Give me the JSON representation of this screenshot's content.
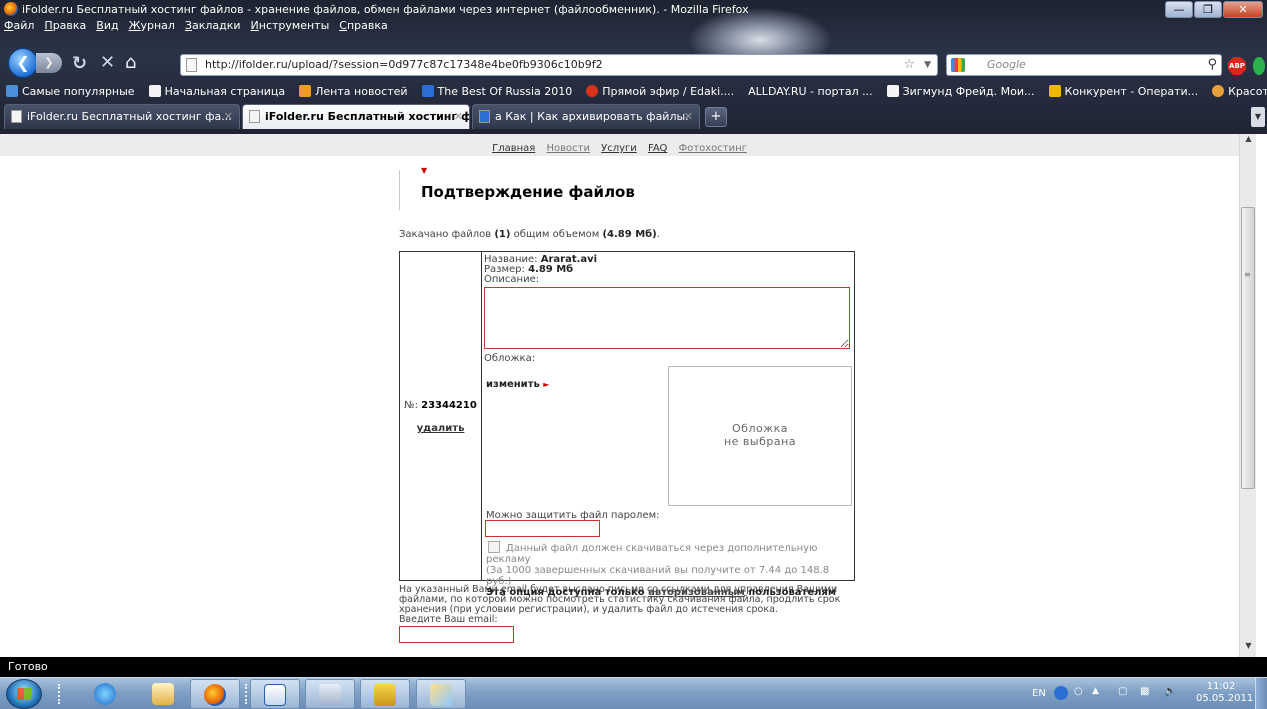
{
  "window": {
    "title": "iFolder.ru Бесплатный хостинг файлов - хранение файлов, обмен файлами через интернет (файлообменник). - Mozilla Firefox"
  },
  "menubar": [
    "Файл",
    "Правка",
    "Вид",
    "Журнал",
    "Закладки",
    "Инструменты",
    "Справка"
  ],
  "navbar": {
    "url": "http://ifolder.ru/upload/?session=0d977c87c17348e4be0fb9306c10b9f2",
    "search_placeholder": "Google"
  },
  "bookmarks": [
    {
      "label": "Самые популярные",
      "color": "#4a90d9"
    },
    {
      "label": "Начальная страница",
      "color": "#f4f4f4"
    },
    {
      "label": "Лента новостей",
      "color": "#f29a24"
    },
    {
      "label": "The Best Of Russia 2010",
      "color": "#2a6fd1"
    },
    {
      "label": "Прямой эфир / Edaki....",
      "color": "#d9321a"
    },
    {
      "label": "ALLDAY.RU - портал ...",
      "color": "#9ca6b8"
    },
    {
      "label": "Зигмунд Фрейд. Мои...",
      "color": "#f4f4f4"
    },
    {
      "label": "Конкурент - Операти...",
      "color": "#f0b800"
    },
    {
      "label": "Красота - Мода (раст...",
      "color": "#e8a03c"
    }
  ],
  "tabs": [
    {
      "label": "iFolder.ru Бесплатный хостинг фа...",
      "active": false
    },
    {
      "label": "iFolder.ru Бесплатный хостинг ф...",
      "active": true
    },
    {
      "label": "а Как | Как архивировать файлы.",
      "active": false
    }
  ],
  "site_menu": [
    {
      "label": "Главная",
      "dim": false
    },
    {
      "label": "Новости",
      "dim": true
    },
    {
      "label": "Услуги",
      "dim": false
    },
    {
      "label": "FAQ",
      "dim": false
    },
    {
      "label": "Фотохостинг",
      "dim": true
    }
  ],
  "page": {
    "heading": "Подтверждение файлов",
    "summary_prefix": "Закачано файлов",
    "summary_count": "(1)",
    "summary_mid": "общим объемом",
    "summary_size": "(4.89 Мб)",
    "summary_end": "."
  },
  "file": {
    "number_label": "№:",
    "number": "23344210",
    "delete_label": "удалить",
    "name_label": "Название:",
    "name": "Ararat.avi",
    "size_label": "Размер:",
    "size": "4.89 Мб",
    "description_label": "Описание:",
    "description_value": "",
    "cover_label": "Обложка:",
    "change_label": "изменить",
    "cover_none_line1": "Обложка",
    "cover_none_line2": "не выбрана",
    "password_label": "Можно защитить файл паролем:",
    "password_value": "",
    "ad_checkbox_label": "Данный файл должен скачиваться через дополнительную рекламу",
    "ad_note": "(За 1000 завершенных скачиваний вы получите от 7.44 до 148.8 руб.)",
    "ad_only_prefix": "Эта опция доступна только",
    "ad_only_link": "авторизованным",
    "ad_only_suffix": "пользователям"
  },
  "email": {
    "note": "На указанный Вами email будет выслано письмо со ссылками для управления Вашими файлами, по которой можно посмотреть статистику скачивания файла, продлить срок хранения (при условии регистрации), и удалить файл до истечения срока.",
    "label": "Введите Ваш email:",
    "value": ""
  },
  "statusbar": {
    "text": "Готово"
  },
  "taskbar": {
    "lang": "EN",
    "time": "11:02",
    "date": "05.05.2011"
  }
}
